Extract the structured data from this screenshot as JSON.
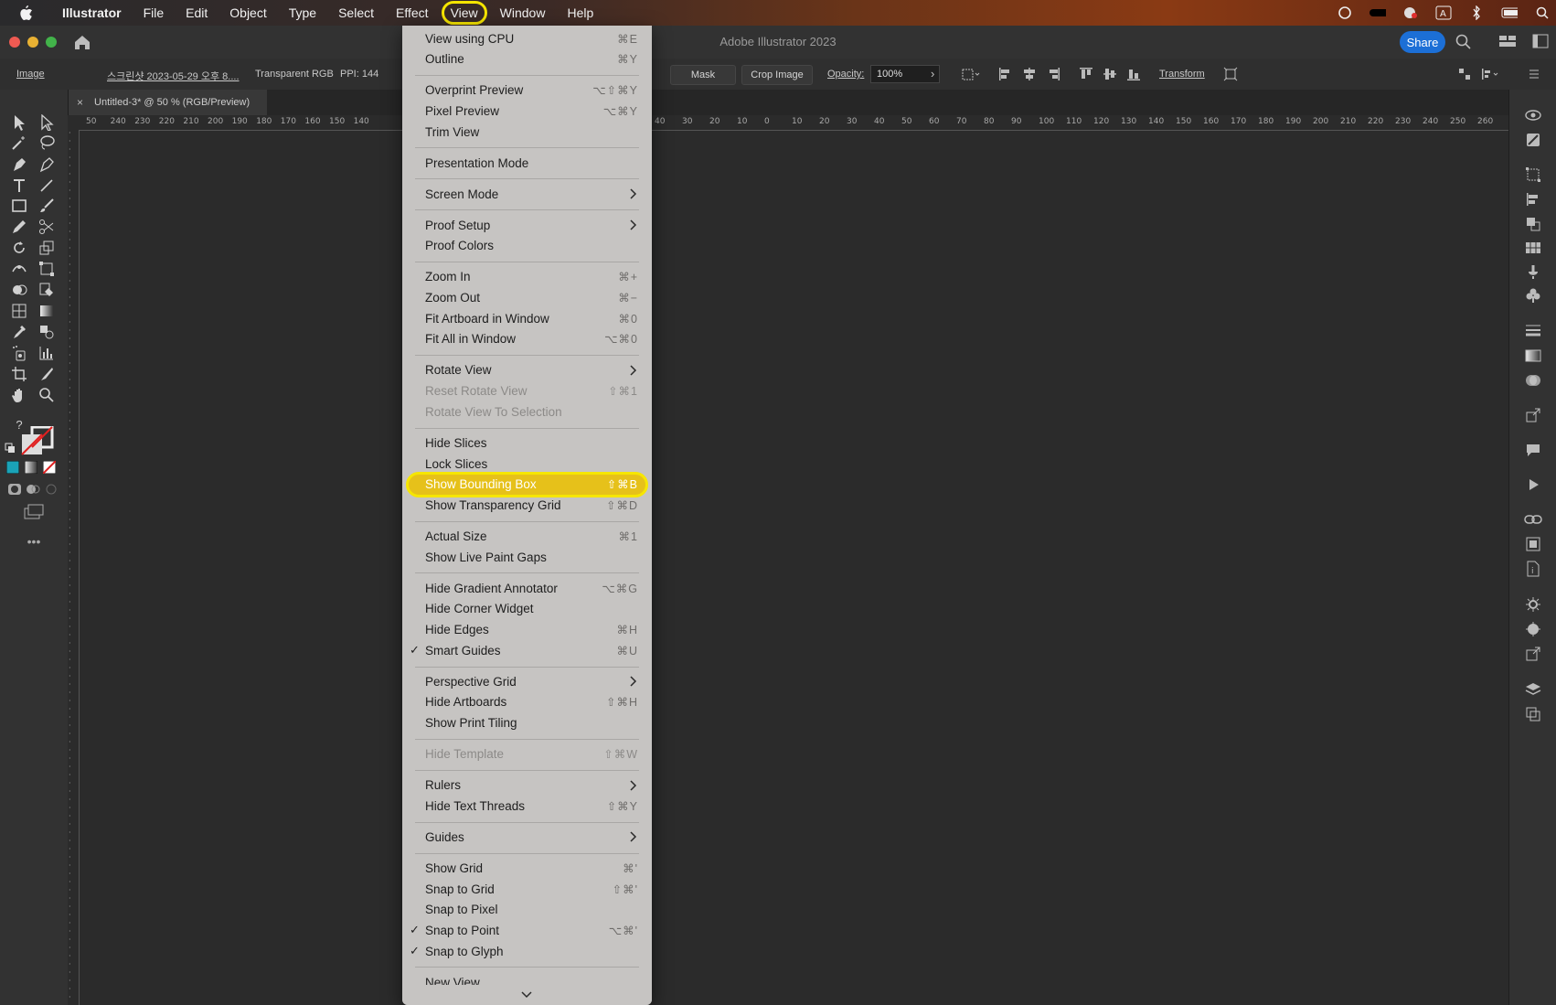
{
  "menubar": {
    "app": "Illustrator",
    "items": [
      "File",
      "Edit",
      "Object",
      "Type",
      "Select",
      "Effect",
      "View",
      "Window",
      "Help"
    ]
  },
  "titlebar": {
    "title": "Adobe Illustrator 2023",
    "share": "Share"
  },
  "controlbar": {
    "object_type": "Image",
    "file_name": "스크린샷 2023-05-29 오후 8....",
    "color_mode": "Transparent RGB",
    "ppi": "PPI: 144",
    "mask": "Mask",
    "crop_image": "Crop Image",
    "opacity_label": "Opacity:",
    "opacity_value": "100%",
    "transform": "Transform"
  },
  "document_tab": {
    "title": "Untitled-3* @ 50 % (RGB/Preview)"
  },
  "rulers": {
    "horizontal_left": [
      "50",
      "240",
      "230",
      "220",
      "210",
      "200",
      "190",
      "180",
      "170",
      "160",
      "150",
      "140"
    ],
    "horizontal_right": [
      "40",
      "30",
      "20",
      "10",
      "0",
      "10",
      "20",
      "30",
      "40",
      "50",
      "60",
      "70",
      "80",
      "90",
      "100",
      "110",
      "120",
      "130",
      "140",
      "150",
      "160",
      "170",
      "180",
      "190",
      "200",
      "210",
      "220",
      "230",
      "240",
      "250",
      "260"
    ]
  },
  "view_menu": {
    "items": [
      {
        "label": "View using CPU",
        "shortcut": "⌘E"
      },
      {
        "label": "Outline",
        "shortcut": "⌘Y"
      },
      {
        "sep": true
      },
      {
        "label": "Overprint Preview",
        "shortcut": "⌥⇧⌘Y"
      },
      {
        "label": "Pixel Preview",
        "shortcut": "⌥⌘Y"
      },
      {
        "label": "Trim View",
        "shortcut": ""
      },
      {
        "sep": true
      },
      {
        "label": "Presentation Mode",
        "shortcut": ""
      },
      {
        "sep": true
      },
      {
        "label": "Screen Mode",
        "submenu": true
      },
      {
        "sep": true
      },
      {
        "label": "Proof Setup",
        "submenu": true
      },
      {
        "label": "Proof Colors",
        "shortcut": ""
      },
      {
        "sep": true
      },
      {
        "label": "Zoom In",
        "shortcut": "⌘+"
      },
      {
        "label": "Zoom Out",
        "shortcut": "⌘−"
      },
      {
        "label": "Fit Artboard in Window",
        "shortcut": "⌘0"
      },
      {
        "label": "Fit All in Window",
        "shortcut": "⌥⌘0"
      },
      {
        "sep": true
      },
      {
        "label": "Rotate View",
        "submenu": true
      },
      {
        "label": "Reset Rotate View",
        "shortcut": "⇧⌘1",
        "disabled": true
      },
      {
        "label": "Rotate View To Selection",
        "shortcut": "",
        "disabled": true
      },
      {
        "sep": true
      },
      {
        "label": "Hide Slices",
        "shortcut": ""
      },
      {
        "label": "Lock Slices",
        "shortcut": ""
      },
      {
        "label": "Show Bounding Box",
        "shortcut": "⇧⌘B",
        "highlight": true
      },
      {
        "label": "Show Transparency Grid",
        "shortcut": "⇧⌘D"
      },
      {
        "sep": true
      },
      {
        "label": "Actual Size",
        "shortcut": "⌘1"
      },
      {
        "label": "Show Live Paint Gaps",
        "shortcut": ""
      },
      {
        "sep": true
      },
      {
        "label": "Hide Gradient Annotator",
        "shortcut": "⌥⌘G"
      },
      {
        "label": "Hide Corner Widget",
        "shortcut": ""
      },
      {
        "label": "Hide Edges",
        "shortcut": "⌘H"
      },
      {
        "label": "Smart Guides",
        "shortcut": "⌘U",
        "checked": true
      },
      {
        "sep": true
      },
      {
        "label": "Perspective Grid",
        "submenu": true
      },
      {
        "label": "Hide Artboards",
        "shortcut": "⇧⌘H"
      },
      {
        "label": "Show Print Tiling",
        "shortcut": ""
      },
      {
        "sep": true
      },
      {
        "label": "Hide Template",
        "shortcut": "⇧⌘W",
        "disabled": true
      },
      {
        "sep": true
      },
      {
        "label": "Rulers",
        "submenu": true
      },
      {
        "label": "Hide Text Threads",
        "shortcut": "⇧⌘Y"
      },
      {
        "sep": true
      },
      {
        "label": "Guides",
        "submenu": true
      },
      {
        "sep": true
      },
      {
        "label": "Show Grid",
        "shortcut": "⌘'"
      },
      {
        "label": "Snap to Grid",
        "shortcut": "⇧⌘'"
      },
      {
        "label": "Snap to Pixel",
        "shortcut": ""
      },
      {
        "label": "Snap to Point",
        "shortcut": "⌥⌘'",
        "checked": true
      },
      {
        "label": "Snap to Glyph",
        "shortcut": "",
        "checked": true
      },
      {
        "sep": true
      },
      {
        "label": "New View",
        "shortcut": ""
      }
    ],
    "check_glyph": "✓"
  },
  "colors": {
    "highlight": "#f6e600",
    "menu_bg": "#c6c4c2",
    "share": "#1c6fd6"
  }
}
